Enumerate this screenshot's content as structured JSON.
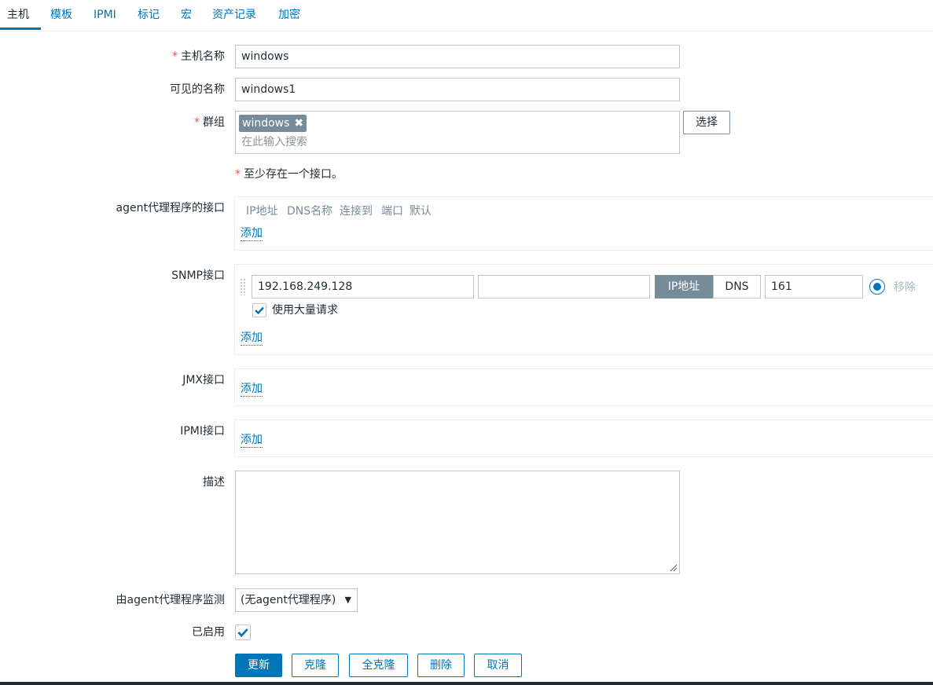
{
  "tabs": [
    "主机",
    "模板",
    "IPMI",
    "标记",
    "宏",
    "资产记录",
    "加密"
  ],
  "form": {
    "hostname_label": "主机名称",
    "hostname_value": "windows",
    "visible_name_label": "可见的名称",
    "visible_name_value": "windows1",
    "groups_label": "群组",
    "group_tag": "windows",
    "group_tag_remove": "✖",
    "groups_placeholder": "在此输入搜索",
    "select_button": "选择",
    "interface_note": "至少存在一个接口。",
    "required_mark": "*"
  },
  "agent_interfaces": {
    "label": "agent代理程序的接口",
    "columns": [
      "IP地址",
      "DNS名称",
      "连接到",
      "端口",
      "默认"
    ],
    "add_link": "添加"
  },
  "snmp_interfaces": {
    "label": "SNMP接口",
    "ip": "192.168.249.128",
    "dns": "",
    "connect_ip": "IP地址",
    "connect_dns": "DNS",
    "connect_selected": "IP地址",
    "port": "161",
    "default": true,
    "remove_link": "移除",
    "bulk_label": "使用大量请求",
    "bulk_checked": true,
    "add_link": "添加"
  },
  "jmx_interfaces": {
    "label": "JMX接口",
    "add_link": "添加"
  },
  "ipmi_interfaces": {
    "label": "IPMI接口",
    "add_link": "添加"
  },
  "description": {
    "label": "描述",
    "value": ""
  },
  "proxy": {
    "label": "由agent代理程序监测",
    "value": "(无agent代理程序)"
  },
  "enabled": {
    "label": "已启用",
    "checked": true
  },
  "actions": {
    "update": "更新",
    "clone": "克隆",
    "full_clone": "全克隆",
    "delete": "删除",
    "cancel": "取消"
  },
  "colors": {
    "accent": "#0275b8",
    "required": "#e45959",
    "tag_bg": "#768d99",
    "border": "#bfc5c8"
  }
}
